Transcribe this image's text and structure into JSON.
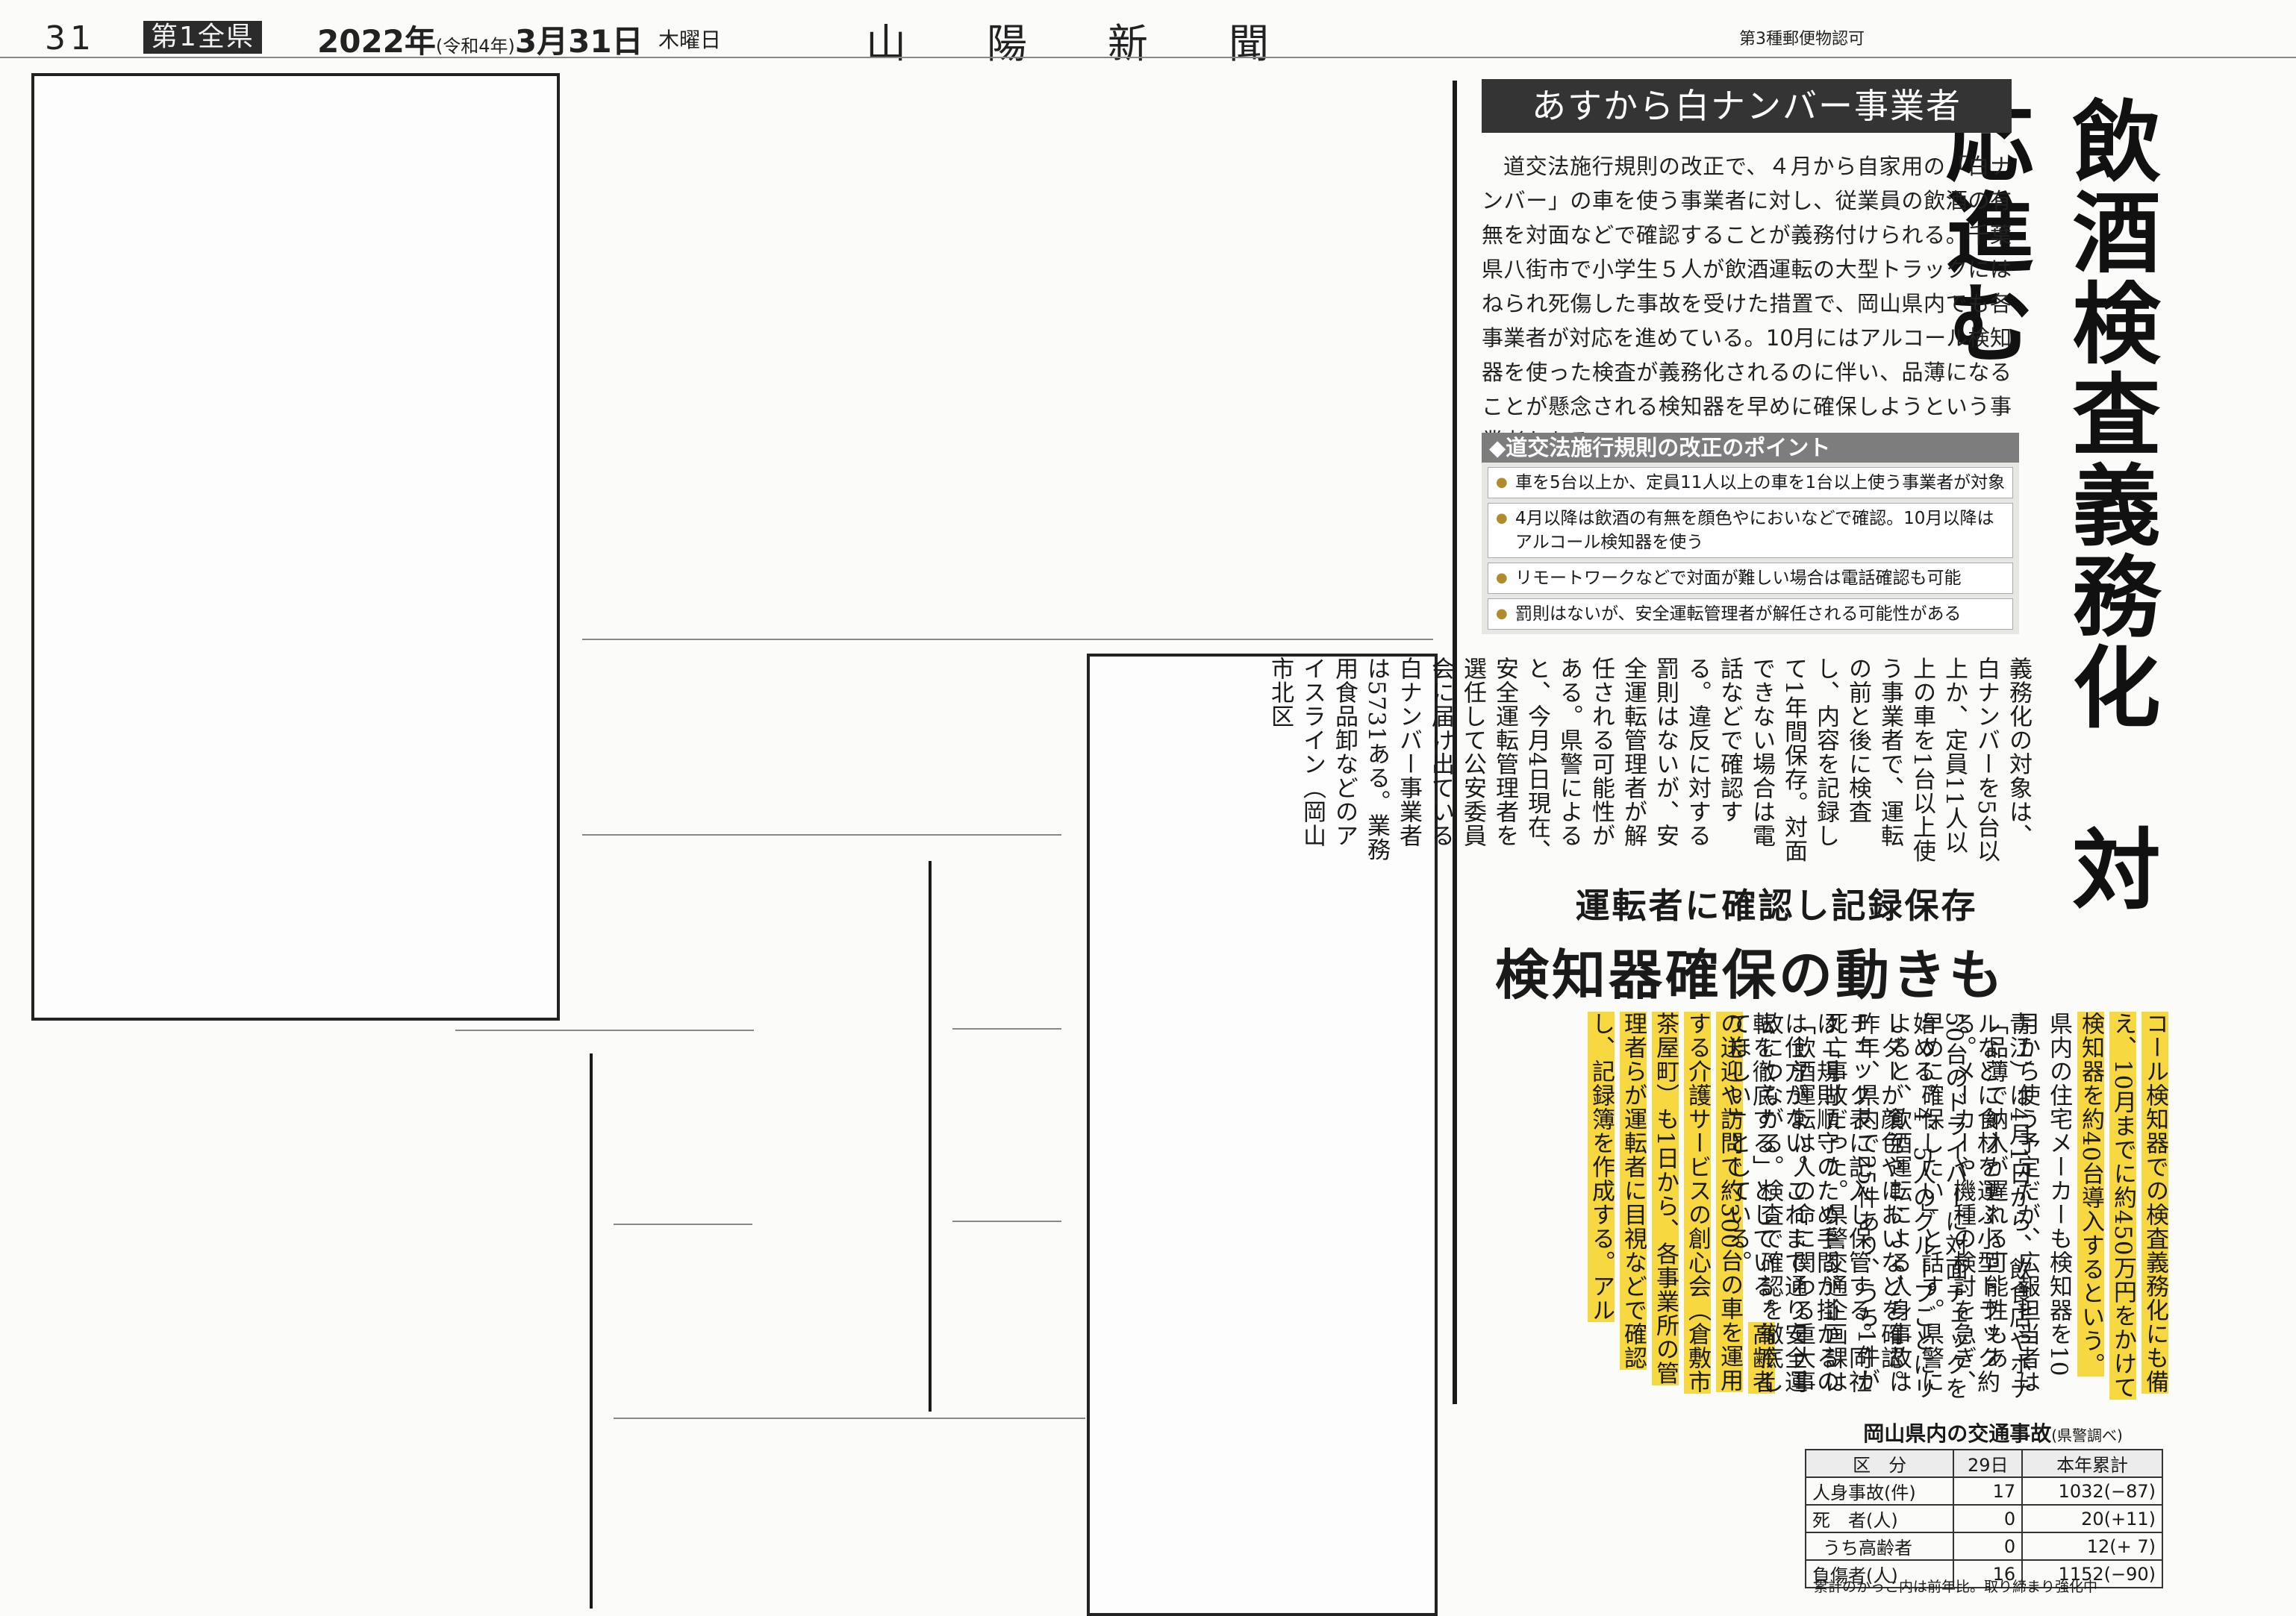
{
  "header": {
    "page": "31",
    "section": "第1全県",
    "date": "2022年",
    "era": "(令和4年)",
    "monthday": "3月31日",
    "weekday": "木曜日",
    "paper": "山陽新聞",
    "permit": "第3種郵便物認可"
  },
  "article": {
    "kicker": "あすから白ナンバー事業者",
    "headline": "飲酒検査義務化　対応進む",
    "lead": "道交法施行規則の改正で、４月から自家用の「白ナンバー」の車を使う事業者に対し、従業員の飲酒の有無を対面などで確認することが義務付けられる。千葉県八街市で小学生５人が飲酒運転の大型トラックにはねられ死傷した事故を受けた措置で、岡山県内でも各事業者が対応を進めている。10月にはアルコール検知器を使った検査が義務化されるのに伴い、品薄になることが懸念される検知器を早めに確保しようという事業者もある。",
    "points_title": "◆道交法施行規則の改正のポイント",
    "points": [
      "車を5台以上か、定員11人以上の車を1台以上使う事業者が対象",
      "4月以降は飲酒の有無を顔色やにおいなどで確認。10月以降はアルコール検知器を使う",
      "リモートワークなどで対面が難しい場合は電話確認も可能",
      "罰則はないが、安全運転管理者が解任される可能性がある"
    ],
    "col1": "義務化の対象は、白ナンバーを5台以上か、定員11人以上の車を1台以上使う事業者で、運転の前と後に検査し、内容を記録して1年間保存。対面できない場合は電話などで確認する。違反に対する罰則はないが、安全運転管理者が解任される可能性がある。県警によると、今月4日現在、安全運転管理者を選任して公安委員会に届け出ている白ナンバー事業者は5731ある。業務用食品卸などのアイスライン（岡山市北区",
    "subhead1": "運転者に確認し記録保存",
    "subhead2": "検知器確保の動きも",
    "col2a": "青江）は4月1日から、飲食店やホテルなどに食材を運ぶ小型トラック約50台のドライバーに対面チェックを始める。4、5人のグループごとにリーダーが顔色やにおいなどを確認。チェック表に記入し保管する。同社は「規則順守のため手間が掛かるのは仕方がない。これまで通り安全運転を徹底する」としている。",
    "col2b_hl": "高齢者の送迎や訪問で約300台の車を運用する介護サービスの創心会（倉敷市茶屋町）も1日から、各事業所の管理者らが運転者に目視などで確認し、記録簿を作成する。アル",
    "col3a_hl": "コール検知器での検査義務化にも備え、10月までに約450万円をかけて検知器を約40台導入するという。",
    "col3a": "県内の住宅メーカーも検知器を10月から使う予定だが、広報担当者は「品薄で納入が遅れる可能性もある。メーカーや機種の検討を急ぎ、早めに確保したい」と話す。県警によると、飲酒運転による人身事故は昨年、県内で25件あり、うち1件が死亡事故だった。県警交通企画課は「飲酒運転は人の命に関わる重大事故につながる。検査で確認を徹底してほしい」としている。"
  },
  "accident_table": {
    "title": "岡山県内の交通事故",
    "source": "(県警調べ)",
    "headers": [
      "区　分",
      "29日",
      "本年累計"
    ],
    "rows": [
      {
        "label": "人身事故(件)",
        "day": "17",
        "total": "1032(−87)"
      },
      {
        "label": "死　者(人)",
        "day": "0",
        "total": "20(+11)"
      },
      {
        "label": "うち高齢者",
        "day": "0",
        "total": "12(+ 7)"
      },
      {
        "label": "負傷者(人)",
        "day": "16",
        "total": "1152(−90)"
      }
    ],
    "note": "累計のかっこ内は前年比。取り締まり強化中"
  }
}
